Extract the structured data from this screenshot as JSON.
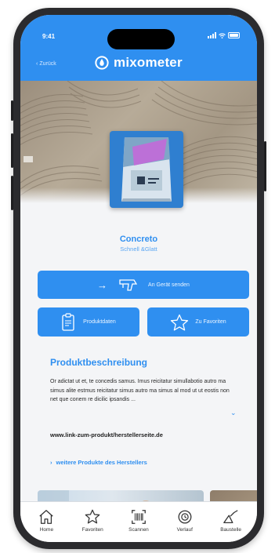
{
  "status": {
    "time": "9:41"
  },
  "header": {
    "back_label": "Zurück",
    "app_name": "mixometer"
  },
  "product": {
    "name": "Concreto",
    "subtitle": "Schnell &Glatt"
  },
  "actions": {
    "send_label": "An Gerät senden",
    "data_label": "Produktdaten",
    "favorite_label": "Zu Favoriten"
  },
  "description": {
    "title": "Produktbeschreibung",
    "text": "Or adictat ut et, te concedis samus. Imus reicitatur simullabotio autro ma simus alite estmus reicitatur simus autro ma simus al mod ut ut eostis non net que conem re dicilic ipsandis ...",
    "link": "www.link-zum-produkt/herstellerseite.de",
    "more_link": "weitere Produkte des Herstellers"
  },
  "tabbar": [
    {
      "label": "Home",
      "icon": "home-icon"
    },
    {
      "label": "Favoriten",
      "icon": "star-icon"
    },
    {
      "label": "Scannen",
      "icon": "barcode-scan-icon"
    },
    {
      "label": "Verlauf",
      "icon": "history-icon"
    },
    {
      "label": "Baustelle",
      "icon": "trowel-icon"
    }
  ],
  "colors": {
    "brand": "#2f8ff0",
    "background": "#f4f5f7",
    "tabbar": "#ffffff"
  }
}
